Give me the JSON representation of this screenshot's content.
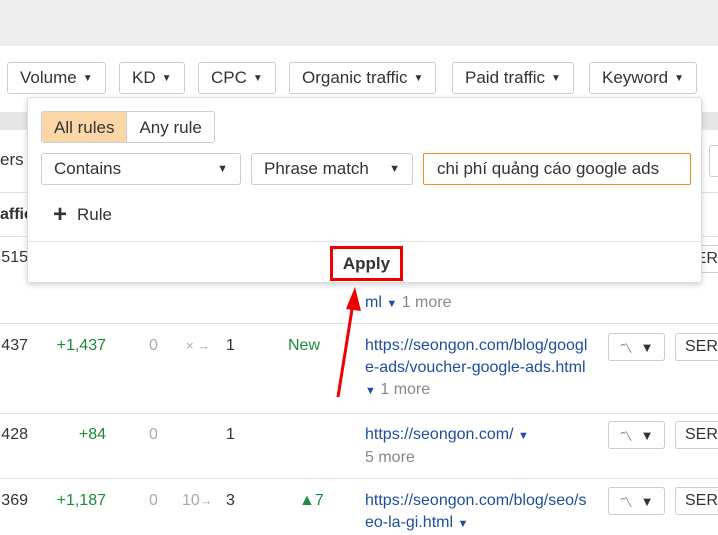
{
  "filters": [
    "Volume",
    "KD",
    "CPC",
    "Organic traffic",
    "Paid traffic",
    "Keyword"
  ],
  "left_cut": {
    "header_partial": "ers",
    "col_header_partial": "affic"
  },
  "popup": {
    "mode_options": [
      "All rules",
      "Any rule"
    ],
    "selected_mode": "All rules",
    "condition": "Contains",
    "match_type": "Phrase match",
    "value": "chi phí quảng cáo google ads",
    "add_rule": "Rule",
    "apply": "Apply"
  },
  "rows": [
    {
      "traffic": "515",
      "url_tail": "ml",
      "more": "1 more",
      "serp": "SER"
    },
    {
      "traffic": "437",
      "change": "+1,437",
      "zero": "0",
      "pos_from": "×",
      "pos_to": "1",
      "pos_change": "New",
      "url": "https://seongon.com/blog/google-ads/voucher-google-ads.html",
      "more": "1 more",
      "serp": "SER"
    },
    {
      "traffic": "428",
      "change": "+84",
      "zero": "0",
      "pos_from": "",
      "pos_to": "1",
      "pos_change": "",
      "url": "https://seongon.com/",
      "more": "5 more",
      "serp": "SER"
    },
    {
      "traffic": "369",
      "change": "+1,187",
      "zero": "0",
      "pos_from": "10",
      "pos_to": "3",
      "pos_change": "▲7",
      "url": "https://seongon.com/blog/seo/seo-la-gi.html",
      "more": "",
      "serp": "SER"
    }
  ],
  "colors": {
    "accent": "#f08c1a",
    "selected_bg": "#fbd7a8",
    "link": "#1f4d9e",
    "positive": "#1a8c3a",
    "highlight": "#ee0000"
  }
}
